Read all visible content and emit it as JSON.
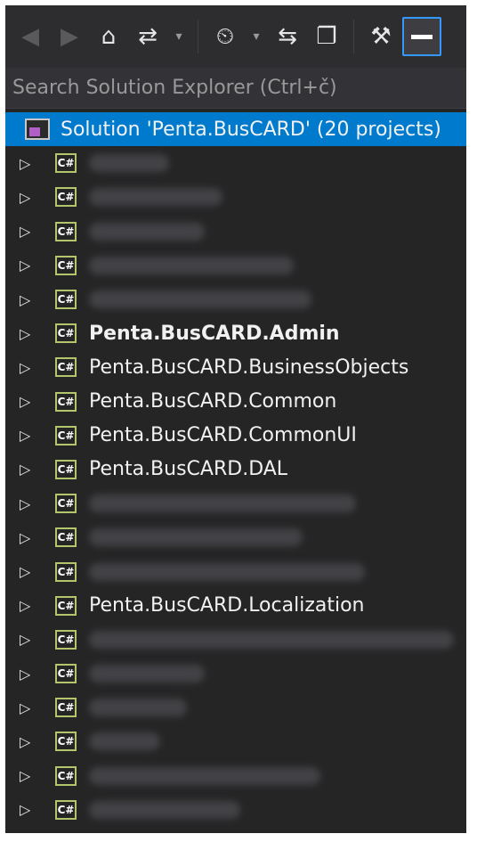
{
  "toolbar": {
    "back_icon": "arrow-left-circle-icon",
    "forward_icon": "arrow-right-circle-icon",
    "home_icon": "home-icon",
    "sync_icon": "sync-with-active-document-icon",
    "history_icon": "pending-changes-icon",
    "collapse_icon": "collapse-all-icon",
    "show_all_icon": "show-all-files-icon",
    "properties_icon": "wrench-icon",
    "preview_icon": "preview-selected-items-icon"
  },
  "search": {
    "placeholder": "Search Solution Explorer (Ctrl+č)"
  },
  "solution": {
    "label": "Solution 'Penta.BusCARD' (20 projects)"
  },
  "projects": [
    {
      "label": "",
      "blurred": true,
      "bold": false
    },
    {
      "label": "",
      "blurred": true,
      "bold": false
    },
    {
      "label": "",
      "blurred": true,
      "bold": false
    },
    {
      "label": "",
      "blurred": true,
      "bold": false
    },
    {
      "label": "",
      "blurred": true,
      "bold": false
    },
    {
      "label": "Penta.BusCARD.Admin",
      "blurred": false,
      "bold": true
    },
    {
      "label": "Penta.BusCARD.BusinessObjects",
      "blurred": false,
      "bold": false
    },
    {
      "label": "Penta.BusCARD.Common",
      "blurred": false,
      "bold": false
    },
    {
      "label": "Penta.BusCARD.CommonUI",
      "blurred": false,
      "bold": false
    },
    {
      "label": "Penta.BusCARD.DAL",
      "blurred": false,
      "bold": false
    },
    {
      "label": "",
      "blurred": true,
      "bold": false
    },
    {
      "label": "",
      "blurred": true,
      "bold": false
    },
    {
      "label": "",
      "blurred": true,
      "bold": false
    },
    {
      "label": "Penta.BusCARD.Localization",
      "blurred": false,
      "bold": false
    },
    {
      "label": "",
      "blurred": true,
      "bold": false
    },
    {
      "label": "",
      "blurred": true,
      "bold": false
    },
    {
      "label": "",
      "blurred": true,
      "bold": false
    },
    {
      "label": "",
      "blurred": true,
      "bold": false
    },
    {
      "label": "",
      "blurred": true,
      "bold": false
    },
    {
      "label": "",
      "blurred": true,
      "bold": false
    }
  ],
  "project_icon_text": "C#",
  "colors": {
    "selection": "#007acc",
    "background": "#252526",
    "csharp_icon_border": "#b4c66b"
  }
}
